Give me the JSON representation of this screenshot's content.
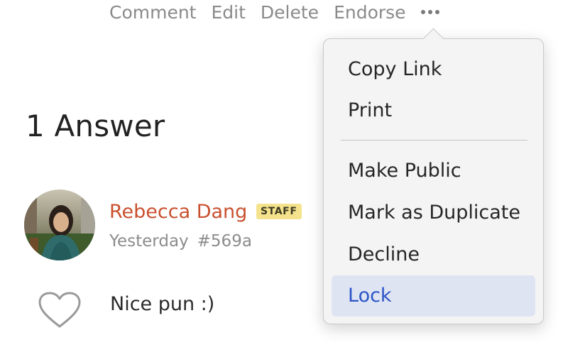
{
  "actions": {
    "comment": "Comment",
    "edit": "Edit",
    "delete": "Delete",
    "endorse": "Endorse"
  },
  "answers": {
    "heading": "1 Answer"
  },
  "answer": {
    "author": "Rebecca Dang",
    "badge": "STAFF",
    "time": "Yesterday",
    "id": "#569a",
    "text": "Nice pun :)",
    "next_line": "... - : : - -, - - - - -"
  },
  "menu": {
    "items": [
      {
        "label": "Copy Link"
      },
      {
        "label": "Print"
      },
      {
        "label": "Make Public"
      },
      {
        "label": "Mark as Duplicate"
      },
      {
        "label": "Decline"
      },
      {
        "label": "Lock",
        "highlighted": true
      }
    ]
  },
  "colors": {
    "author": "#c9502f",
    "badge_bg": "#f4e38c",
    "highlight_bg": "#dfe4f3",
    "highlight_text": "#2a55c7",
    "muted_text": "#8a8a8a"
  },
  "icons": {
    "more": "ellipsis-icon",
    "like": "heart-icon"
  }
}
